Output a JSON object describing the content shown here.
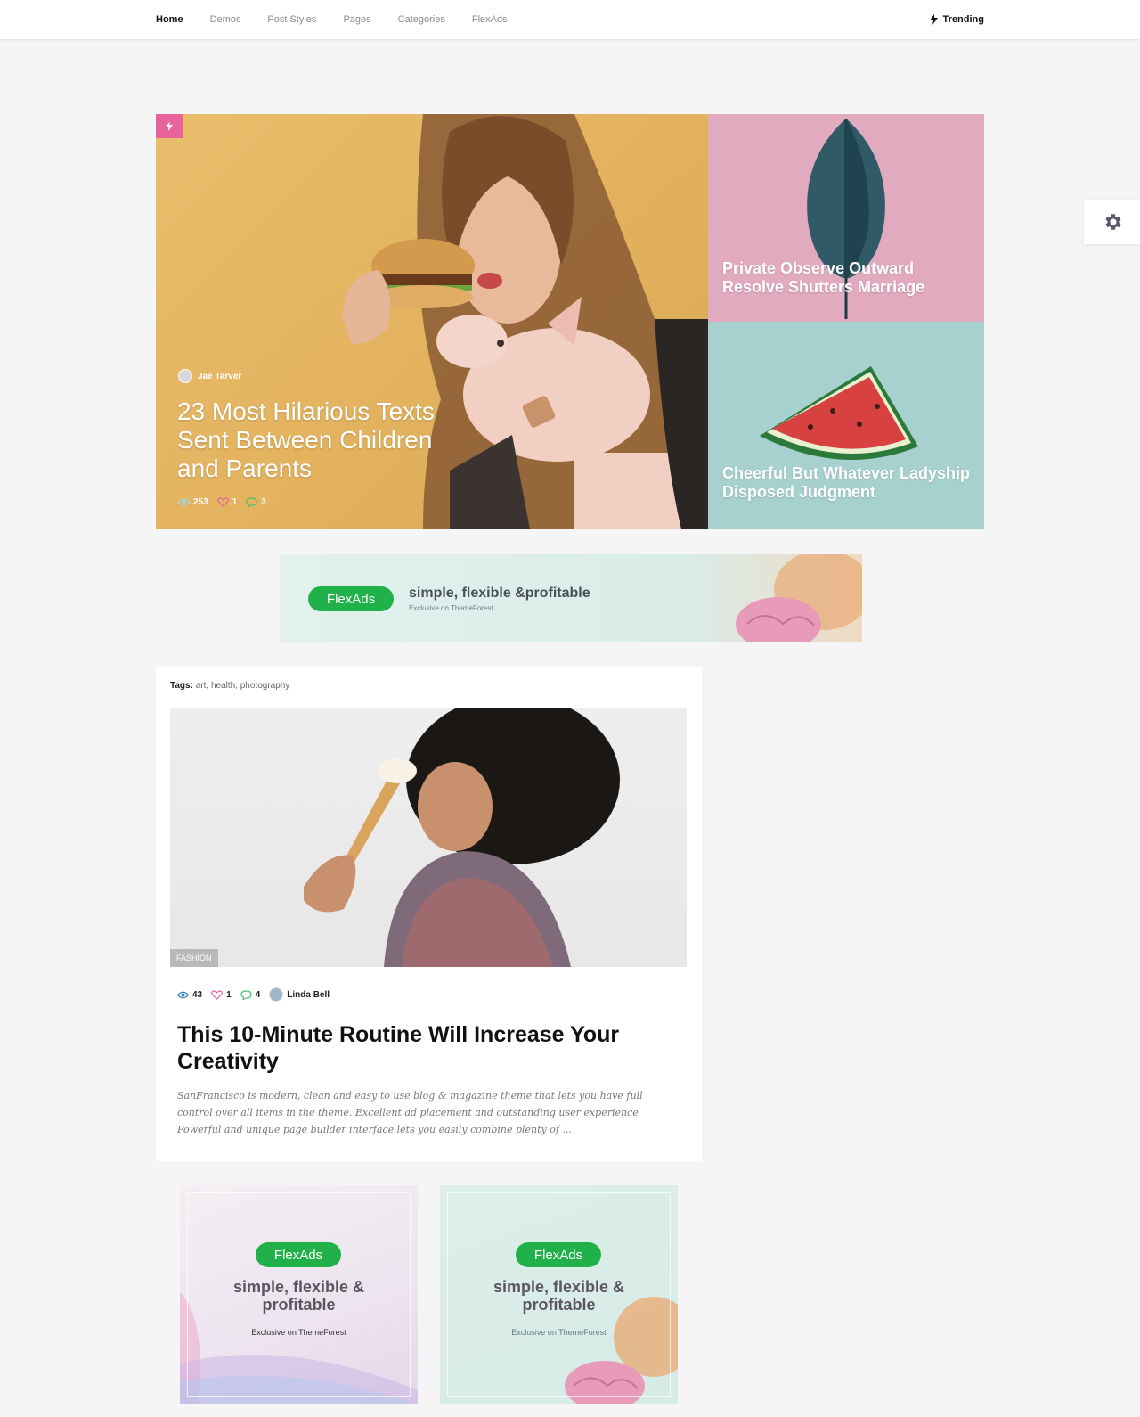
{
  "nav": {
    "items": [
      {
        "label": "Home",
        "active": true
      },
      {
        "label": "Demos",
        "active": false
      },
      {
        "label": "Post Styles",
        "active": false
      },
      {
        "label": "Pages",
        "active": false
      },
      {
        "label": "Categories",
        "active": false
      },
      {
        "label": "FlexAds",
        "active": false
      }
    ],
    "trending_label": "Trending"
  },
  "hero": {
    "main": {
      "author": "Jae Tarver",
      "title": "23 Most Hilarious Texts Sent Between Children and Parents",
      "views": "253",
      "likes": "1",
      "comments": "3",
      "badge_icon": "flash-icon"
    },
    "side_top": {
      "title": "Private Observe Outward Resolve Shutters Marriage"
    },
    "side_bottom": {
      "title": "Cheerful But Whatever Ladyship Disposed Judgment"
    }
  },
  "banner_ad": {
    "pill": "FlexAds",
    "headline": "simple, flexible &profitable",
    "sub": "Exclusive on ThemeForest"
  },
  "article": {
    "tags_label": "Tags:",
    "tags": "art, health, photography",
    "category": "FASHION",
    "views": "43",
    "likes": "1",
    "comments": "4",
    "author": "Linda Bell",
    "title": "This 10-Minute Routine Will Increase Your Creativity",
    "excerpt": "SanFrancisco is modern, clean and easy to use blog & magazine theme that lets you have full control over all items in the theme. Excellent ad placement and outstanding user experience Powerful and unique page builder interface lets you easily combine plenty of ..."
  },
  "square_ads": [
    {
      "pill": "FlexAds",
      "line1": "simple, flexible &",
      "line2": "profitable",
      "sub": "Exclusive on ThemeForest"
    },
    {
      "pill": "FlexAds",
      "line1": "simple, flexible &",
      "line2": "profitable",
      "sub": "Exclusive on ThemeForest"
    }
  ],
  "colors": {
    "accent_pink": "#e8629c",
    "ad_green": "#21b14a",
    "background": "#f5f5f5"
  }
}
